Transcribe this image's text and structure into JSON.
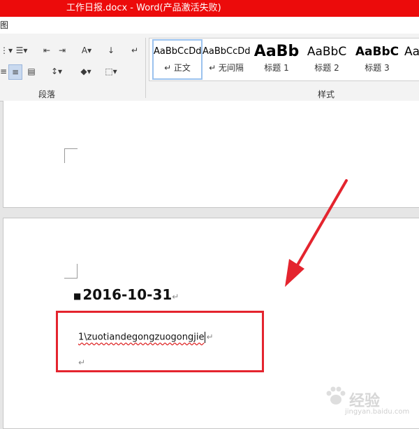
{
  "window": {
    "title": "工作日报.docx - Word(产品激活失败)"
  },
  "tabs": {
    "partial_tab": "图"
  },
  "ribbon": {
    "paragraph_group_label": "段落",
    "styles_group_label": "样式",
    "styles": [
      {
        "preview": "AaBbCcDd",
        "name": "↵ 正文",
        "selected": true
      },
      {
        "preview": "AaBbCcDd",
        "name": "↵ 无间隔"
      },
      {
        "preview": "AaBb",
        "name": "标题 1"
      },
      {
        "preview": "AaBbC",
        "name": "标题 2"
      },
      {
        "preview": "AaBbC",
        "name": "标题 3"
      },
      {
        "preview": "Aa",
        "name": ""
      }
    ]
  },
  "document": {
    "heading": "2016-10-31",
    "paragraph_mark": "↵",
    "body_text": "1\\zuotiandegongzuogongjie",
    "empty_paragraph_mark": "↵"
  },
  "annotation": {
    "box_color": "#e4242e",
    "arrow_color": "#e4242e"
  },
  "watermark": {
    "brand": "经验",
    "url": "jingyan.baidu.com"
  }
}
